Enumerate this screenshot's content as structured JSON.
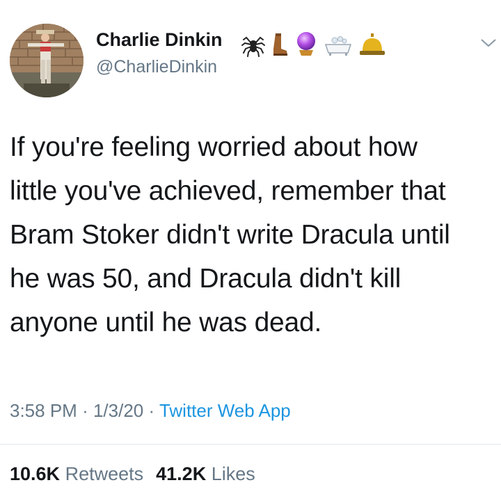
{
  "user": {
    "display_name": "Charlie Dinkin",
    "handle": "@CharlieDinkin",
    "name_emojis": [
      "spider-emoji",
      "boot-emoji",
      "crystal-ball-emoji",
      "bathtub-emoji",
      "bellhop-bell-emoji"
    ]
  },
  "tweet": {
    "lines": [
      "If you're feeling worried about how",
      "little you've achieved, remember that",
      "Bram Stoker didn't write Dracula until",
      "he was 50, and Dracula didn't kill",
      "anyone until he was dead."
    ],
    "time": "3:58 PM",
    "date": "1/3/20",
    "separator": "·",
    "source": "Twitter Web App"
  },
  "stats": {
    "retweets_count": "10.6K",
    "retweets_label": "Retweets",
    "likes_count": "41.2K",
    "likes_label": "Likes"
  },
  "colors": {
    "text": "#14171a",
    "secondary": "#657786",
    "link": "#1b95e0",
    "divider": "#e1e8ed"
  }
}
